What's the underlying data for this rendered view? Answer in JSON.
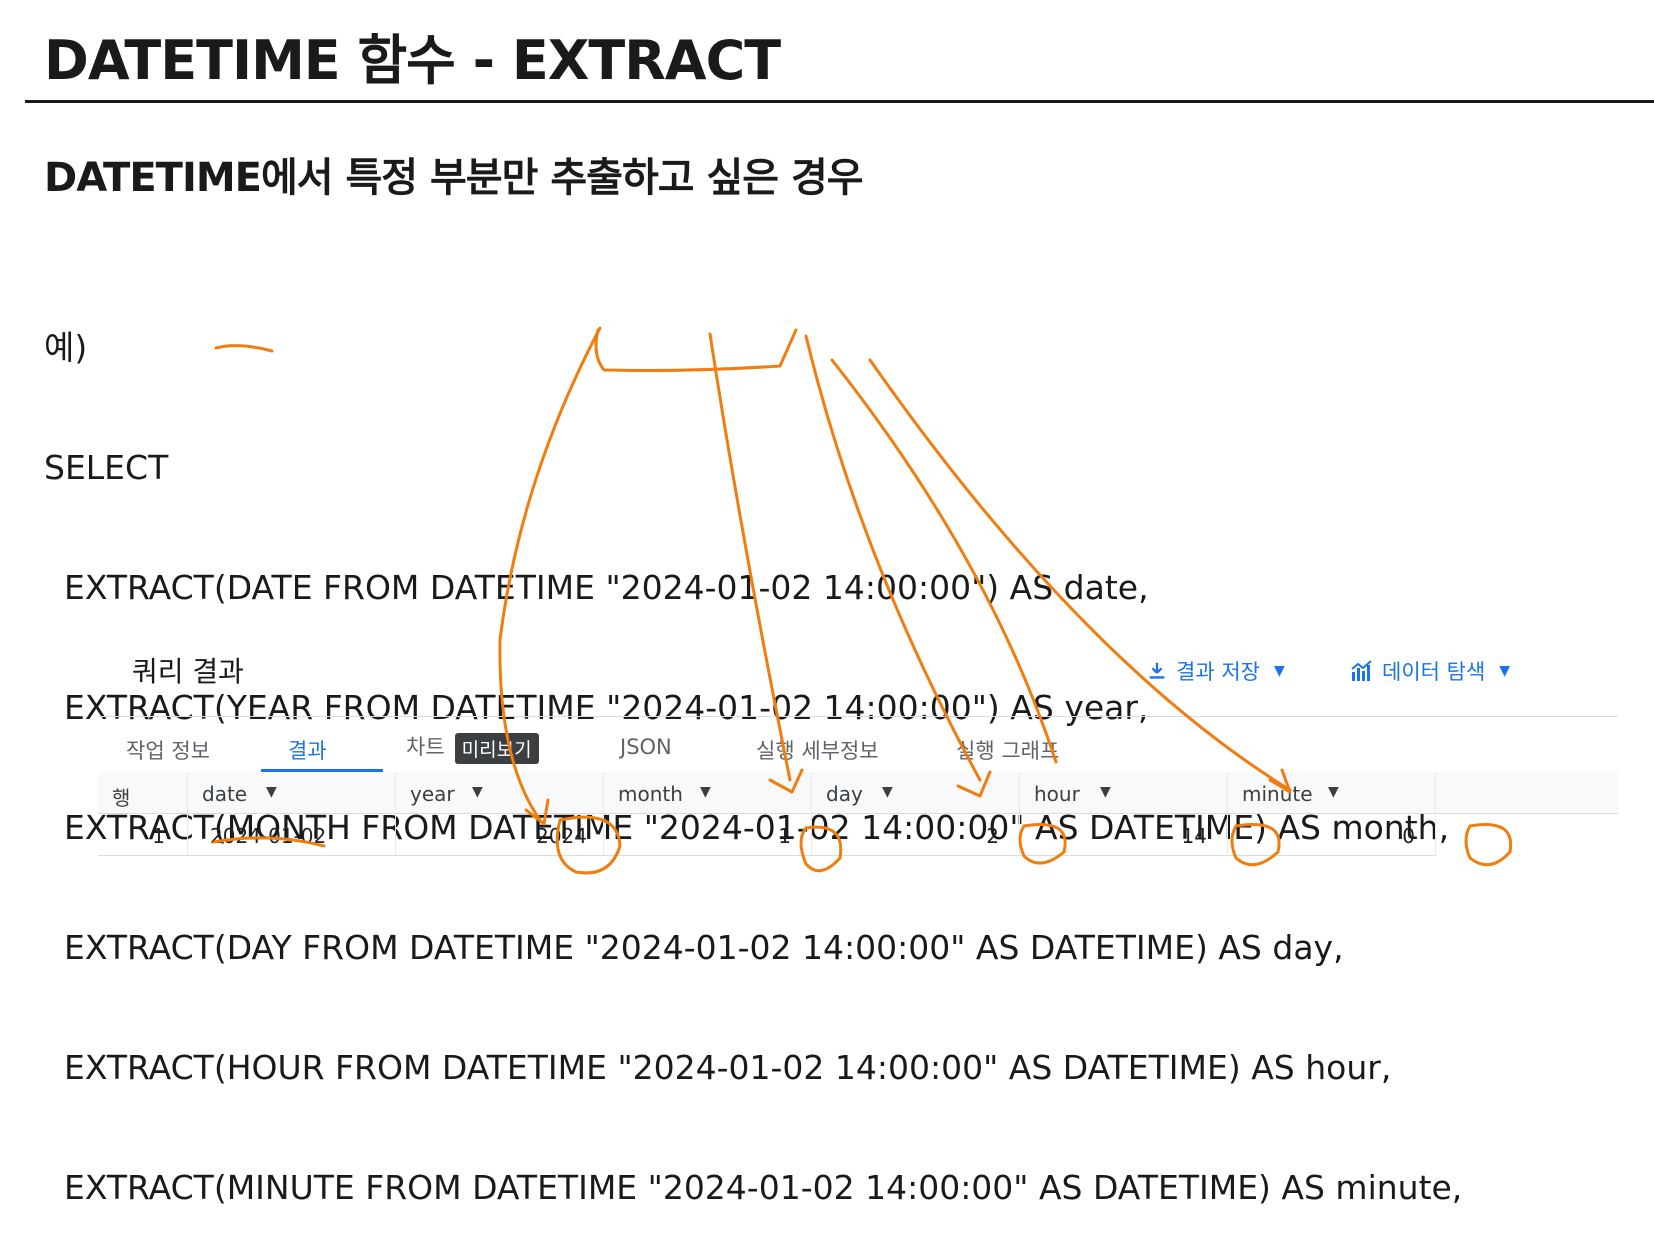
{
  "slide": {
    "title": "DATETIME 함수 - EXTRACT",
    "subtitle": "DATETIME에서 특정 부분만 추출하고 싶은 경우",
    "code_lines": [
      "예)",
      "SELECT",
      "EXTRACT(DATE FROM DATETIME \"2024-01-02 14:00:00\") AS date,",
      "EXTRACT(YEAR FROM DATETIME \"2024-01-02 14:00:00\") AS year,",
      "EXTRACT(MONTH FROM DATETIME \"2024-01-02 14:00:00\" AS DATETIME) AS month,",
      "EXTRACT(DAY FROM DATETIME \"2024-01-02 14:00:00\" AS DATETIME) AS day,",
      "EXTRACT(HOUR FROM DATETIME \"2024-01-02 14:00:00\" AS DATETIME) AS hour,",
      "EXTRACT(MINUTE FROM DATETIME \"2024-01-02 14:00:00\" AS DATETIME) AS minute,"
    ]
  },
  "results_panel": {
    "title": "쿼리 결과",
    "save_label": "결과 저장",
    "explore_label": "데이터 탐색",
    "tabs": [
      "작업 정보",
      "결과",
      "차트",
      "JSON",
      "실행 세부정보",
      "실행 그래프"
    ],
    "chart_badge": "미리보기",
    "columns": [
      "행",
      "date",
      "year",
      "month",
      "day",
      "hour",
      "minute"
    ],
    "row": [
      "1",
      "2024-01-02",
      "2024",
      "1",
      "2",
      "14",
      "0"
    ]
  },
  "colors": {
    "accent": "#1a73e8",
    "annotation": "#f07d0f"
  }
}
